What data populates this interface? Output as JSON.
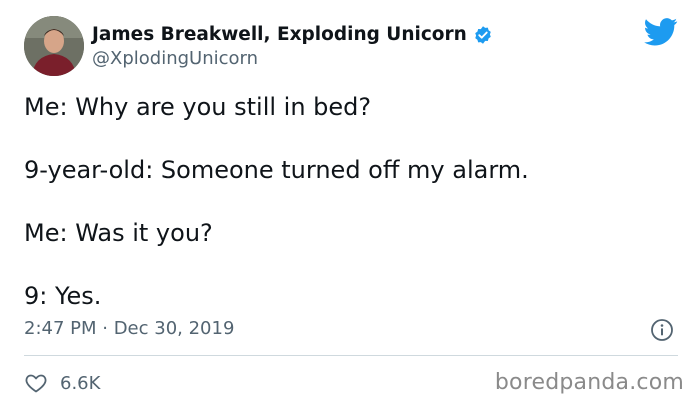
{
  "author": {
    "display_name": "James Breakwell, Exploding Unicorn",
    "handle": "@XplodingUnicorn",
    "verified": true,
    "avatar_icon": "profile-photo"
  },
  "brand_icon": "twitter-bird-icon",
  "tweet": {
    "lines": [
      "Me: Why are you still in bed?",
      "9-year-old: Someone turned off my alarm.",
      "Me: Was it you?",
      "9: Yes."
    ],
    "timestamp": "2:47 PM · Dec 30, 2019"
  },
  "actions": {
    "like_count": "6.6K",
    "info_icon": "info-icon"
  },
  "watermark": "boredpanda.com",
  "colors": {
    "twitter_blue": "#1d9bf0",
    "text": "#0f1419",
    "secondary_text": "#536471",
    "divider": "#cfd9de"
  }
}
